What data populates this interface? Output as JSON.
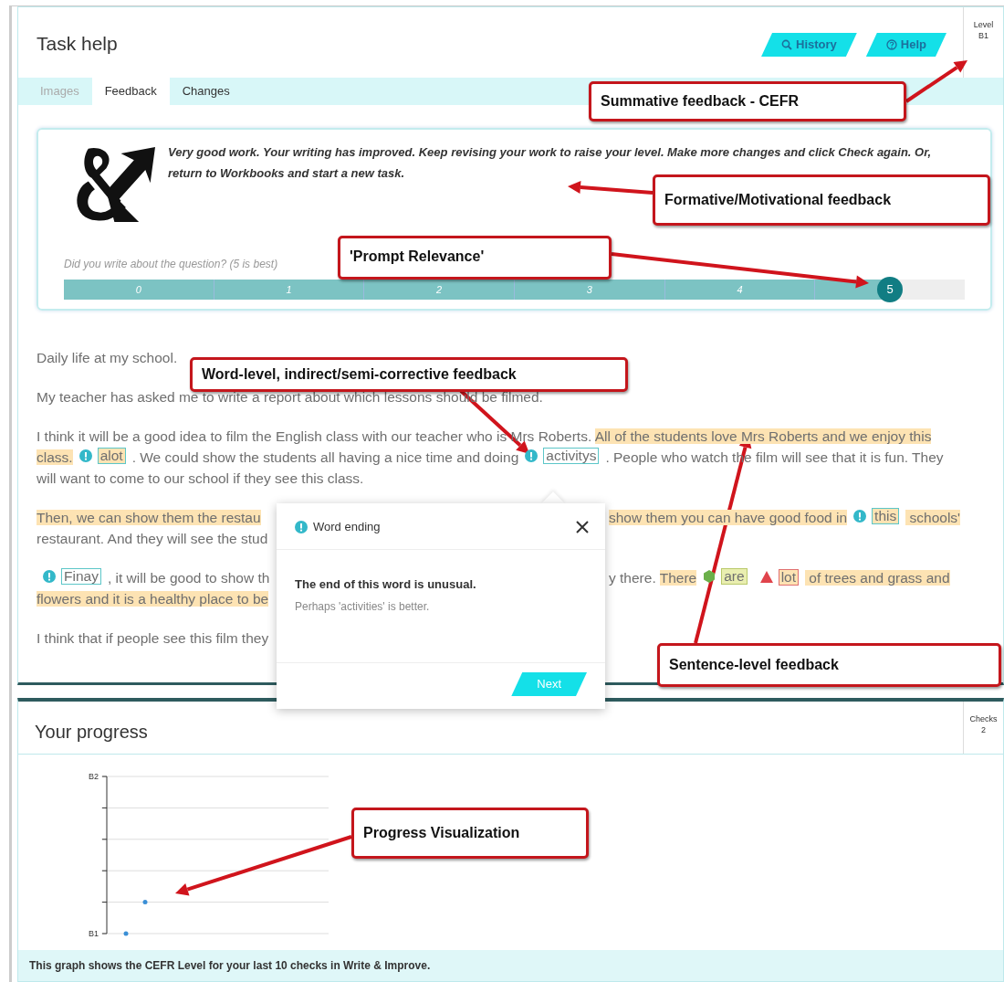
{
  "task_help": {
    "title": "Task help",
    "buttons": [
      {
        "kind": "search",
        "label": "History"
      },
      {
        "kind": "help",
        "label": "Help"
      }
    ],
    "level": {
      "label": "Level",
      "value": "B1"
    },
    "tabs": [
      {
        "label": "Images",
        "selected": false,
        "disabled": true
      },
      {
        "label": "Feedback",
        "selected": true,
        "disabled": false
      },
      {
        "label": "Changes",
        "selected": false,
        "disabled": false
      }
    ],
    "feedback": {
      "message": "Very good work. Your writing has improved. Keep revising your work to raise your level. Make more changes and click Check again. Or, return to Workbooks and start a new task.",
      "question": "Did you write about the question? (5 is best)",
      "scale": [
        {
          "label": "0",
          "selected": false
        },
        {
          "label": "1",
          "selected": false
        },
        {
          "label": "2",
          "selected": false
        },
        {
          "label": "3",
          "selected": false
        },
        {
          "label": "4",
          "selected": false
        },
        {
          "label": "5",
          "selected": true
        }
      ]
    },
    "essay": [
      {
        "lines": [
          {
            "left": [
              {
                "kind": "text",
                "text": "Daily life at my school."
              }
            ]
          }
        ]
      },
      {
        "lines": [
          {
            "left": [
              {
                "kind": "text",
                "text": "My teacher has asked me to write a report about which lessons should be filmed."
              }
            ]
          }
        ]
      },
      {
        "lines": [
          {
            "left": [
              {
                "kind": "text",
                "text": "I think it will be a good idea to film the English class with our teacher who is Mrs Roberts. "
              },
              {
                "kind": "highlight",
                "text": "All of the students love Mrs Roberts and we enjoy this"
              }
            ]
          },
          {
            "left": [
              {
                "kind": "highlight",
                "text": "class."
              },
              {
                "kind": "info_flag",
                "text": "alot",
                "highlighted": true
              },
              {
                "kind": "text",
                "text": ". We could show the students all having a nice time and doing"
              },
              {
                "kind": "info_flag",
                "text": "activitys",
                "highlighted": false
              },
              {
                "kind": "text",
                "text": ". People who watch the film will see that it is fun. They"
              }
            ]
          },
          {
            "left": [
              {
                "kind": "text",
                "text": "will want to come to our school if they see this class."
              }
            ]
          }
        ]
      },
      {
        "lines": [
          {
            "left": [
              {
                "kind": "highlight",
                "text": "Then, we can show them the restau"
              }
            ],
            "right": [
              {
                "kind": "highlight",
                "text": "show them you can have good food in"
              },
              {
                "kind": "info_flag",
                "text": "this",
                "highlighted": true
              },
              {
                "kind": "highlight",
                "text": " schools'"
              }
            ]
          },
          {
            "left": [
              {
                "kind": "text",
                "text": "restaurant. And they will see the stud"
              }
            ]
          }
        ]
      },
      {
        "lines": [
          {
            "left": [
              {
                "kind": "info_flag",
                "text": "Finay",
                "highlighted": false
              },
              {
                "kind": "text",
                "text": ", it will be good to show th"
              }
            ],
            "right": [
              {
                "kind": "text",
                "text": "y there. "
              },
              {
                "kind": "highlight",
                "text": "There"
              },
              {
                "kind": "good_flag",
                "text": "are",
                "highlighted": true
              },
              {
                "kind": "warn_flag",
                "text": "lot",
                "highlighted": true
              },
              {
                "kind": "highlight",
                "text": " of trees and grass and"
              }
            ]
          },
          {
            "left": [
              {
                "kind": "highlight",
                "text": "flowers and it is a healthy place to be"
              }
            ]
          }
        ]
      },
      {
        "lines": [
          {
            "left": [
              {
                "kind": "text",
                "text": "I think that if people see this film they"
              }
            ]
          }
        ]
      }
    ],
    "popup": {
      "title": "Word ending",
      "message": "The end of this word is unusual.",
      "suggestion": "Perhaps 'activities' is better.",
      "button": "Next"
    }
  },
  "progress": {
    "title": "Your progress",
    "checks": {
      "label": "Checks",
      "value": "2"
    },
    "y_axis_labels": [
      "B2",
      "B1"
    ],
    "caption": "This graph shows the CEFR Level for your last 10 checks in Write & Improve."
  },
  "annotations": [
    {
      "text": "Summative feedback - CEFR"
    },
    {
      "text": "Formative/Motivational feedback"
    },
    {
      "text": "'Prompt Relevance'"
    },
    {
      "text": "Word-level, indirect/semi-corrective feedback"
    },
    {
      "text": "Sentence-level feedback"
    },
    {
      "text": "Progress Visualization"
    }
  ]
}
